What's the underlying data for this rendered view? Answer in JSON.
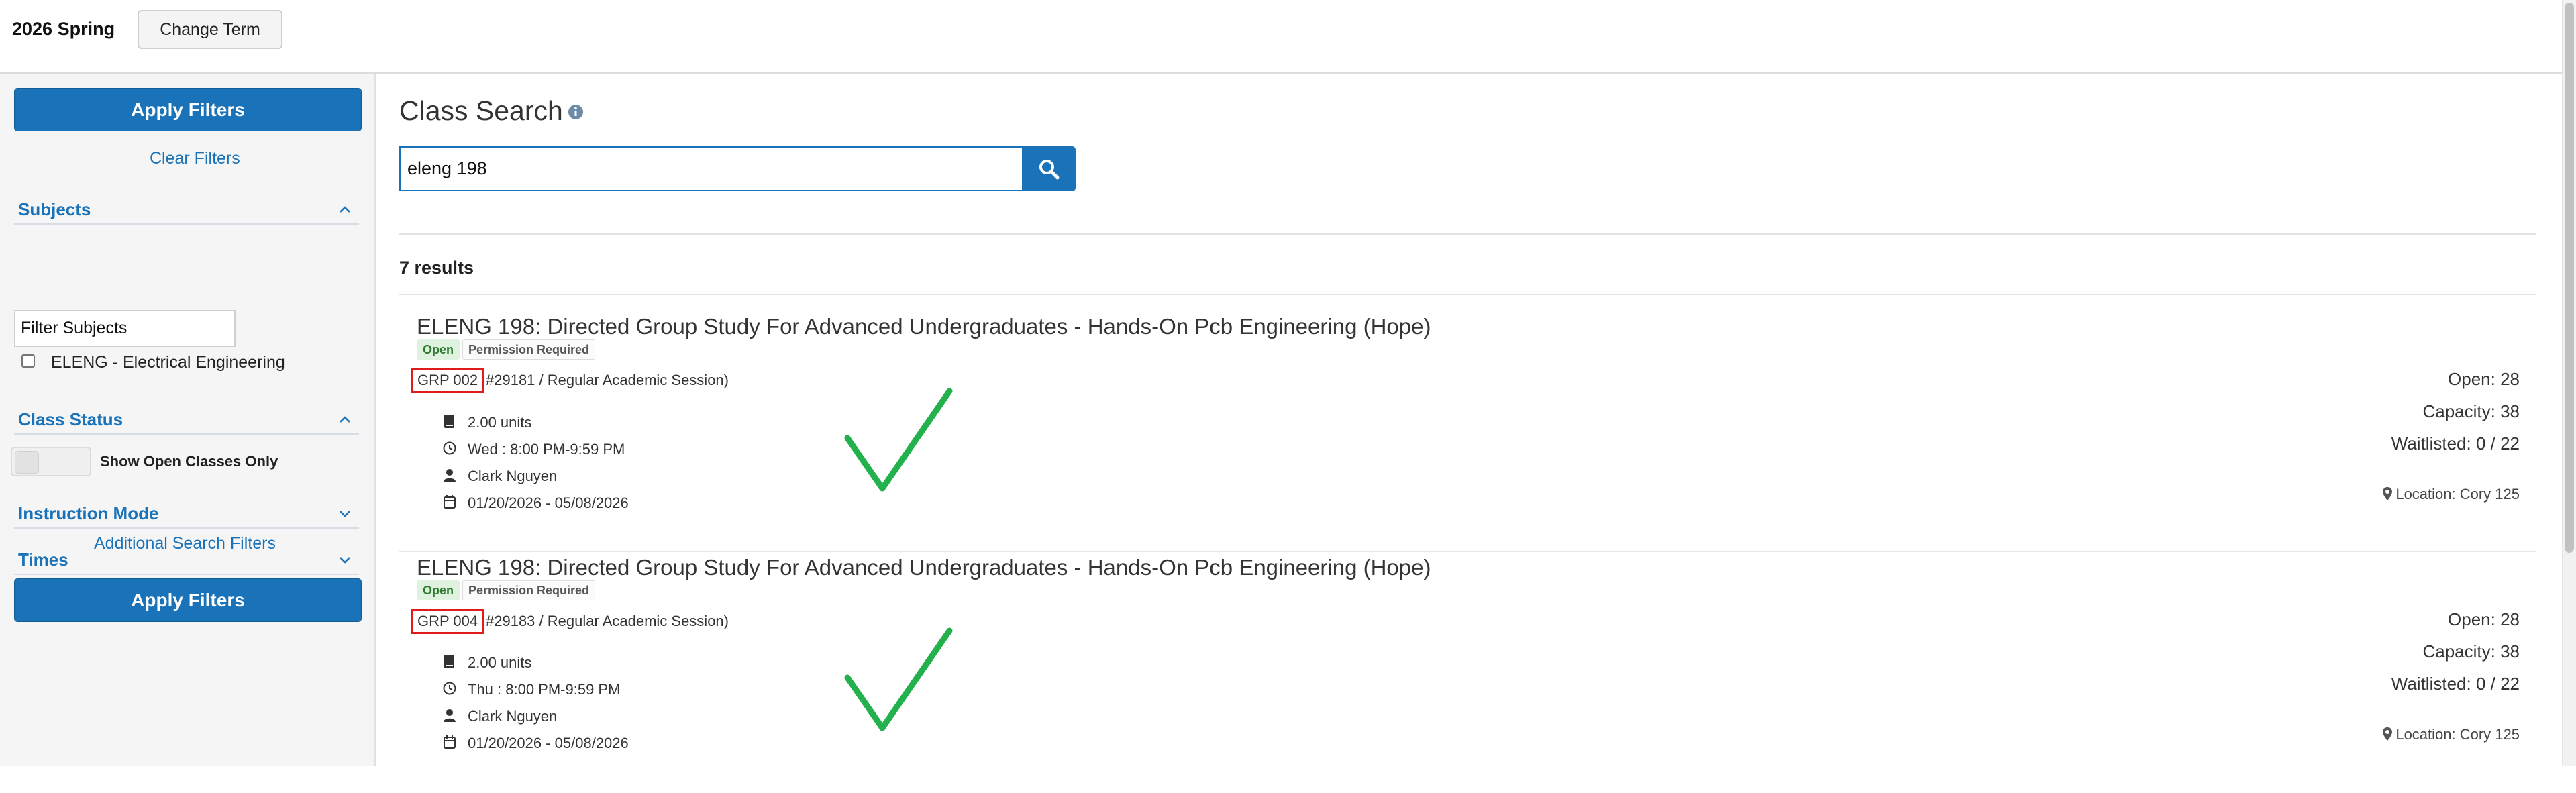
{
  "header": {
    "term": "2026 Spring",
    "change_term_label": "Change Term"
  },
  "sidebar": {
    "apply_filters_label": "Apply Filters",
    "clear_filters_label": "Clear Filters",
    "subjects": {
      "title": "Subjects",
      "filter_placeholder": "Filter Subjects",
      "options": [
        {
          "label": "ELENG - Electrical Engineering",
          "checked": false
        }
      ]
    },
    "class_status": {
      "title": "Class Status",
      "toggle_label": "Show Open Classes Only",
      "toggle_on": false
    },
    "instruction_mode": {
      "title": "Instruction Mode"
    },
    "times": {
      "title": "Times"
    },
    "additional_filters_label": "Additional Search Filters",
    "apply_filters_bottom_label": "Apply Filters"
  },
  "main": {
    "title": "Class Search",
    "search": {
      "value": "eleng 198"
    },
    "results_count": "7 results",
    "results": [
      {
        "title": "ELENG 198: Directed Group Study For Advanced Undergraduates - Hands-On Pcb Engineering (Hope)",
        "status": "Open",
        "permission": "Permission Required",
        "section": "GRP 002",
        "session": "#29181 / Regular Academic Session)",
        "units": "2.00 units",
        "schedule": "Wed : 8:00 PM-9:59 PM",
        "instructor": "Clark Nguyen",
        "dates": "01/20/2026 - 05/08/2026",
        "open": "Open: 28",
        "capacity": "Capacity: 38",
        "waitlisted": "Waitlisted: 0 / 22",
        "location": "Location: Cory 125"
      },
      {
        "title": "ELENG 198: Directed Group Study For Advanced Undergraduates - Hands-On Pcb Engineering (Hope)",
        "status": "Open",
        "permission": "Permission Required",
        "section": "GRP 004",
        "session": "#29183 / Regular Academic Session)",
        "units": "2.00 units",
        "schedule": "Thu : 8:00 PM-9:59 PM",
        "instructor": "Clark Nguyen",
        "dates": "01/20/2026 - 05/08/2026",
        "open": "Open: 28",
        "capacity": "Capacity: 38",
        "waitlisted": "Waitlisted: 0 / 22",
        "location": "Location: Cory 125"
      }
    ]
  },
  "colors": {
    "primary": "#1a73b8",
    "highlight_box": "#e01b1b",
    "checkmark": "#22b14c",
    "open_badge_bg": "#dff2df"
  },
  "icons": [
    "info-icon",
    "search-icon",
    "chevron-up-icon",
    "chevron-down-icon",
    "book-icon",
    "clock-icon",
    "user-icon",
    "calendar-icon",
    "map-pin-icon",
    "checkmark-annotation"
  ]
}
